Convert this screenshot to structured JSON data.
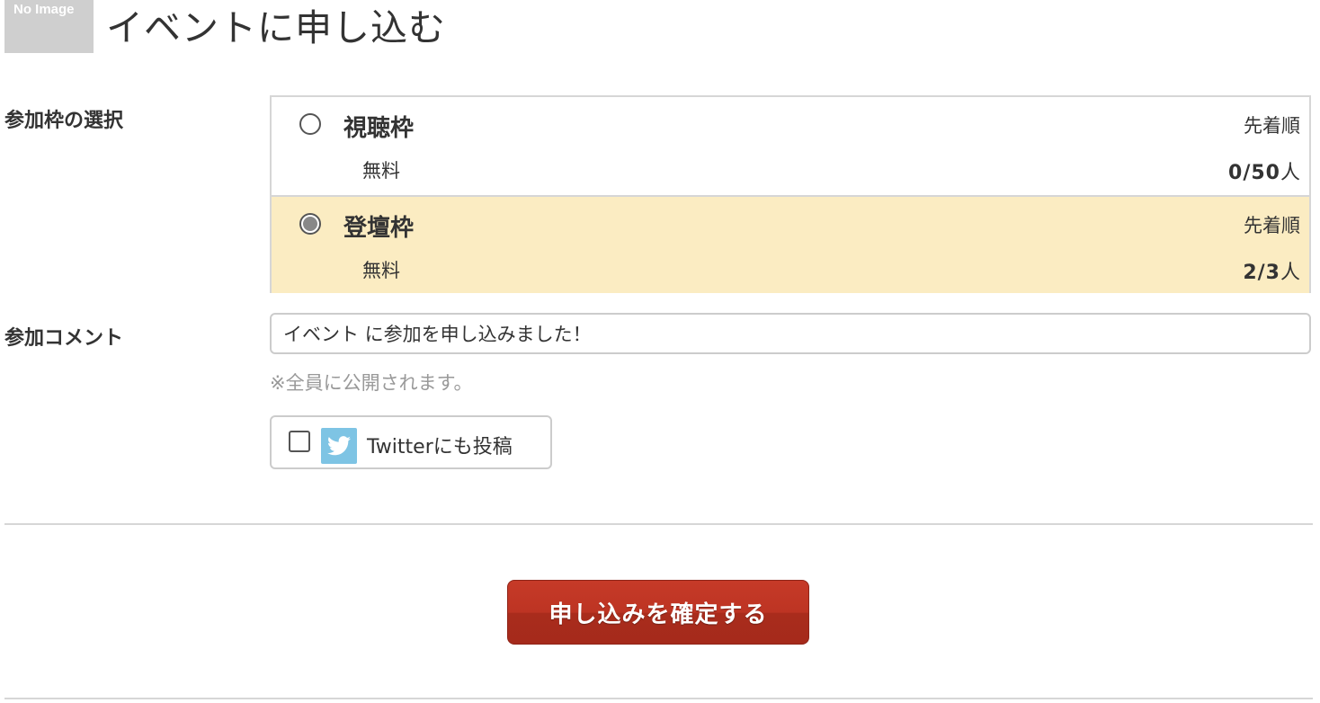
{
  "header": {
    "thumbnail_text": "No Image",
    "title": "イベントに申し込む"
  },
  "slot_selection": {
    "label": "参加枠の選択",
    "options": [
      {
        "name": "視聴枠",
        "order": "先着順",
        "price": "無料",
        "capacity_count": "0/50",
        "capacity_unit": "人",
        "selected": false
      },
      {
        "name": "登壇枠",
        "order": "先着順",
        "price": "無料",
        "capacity_count": "2/3",
        "capacity_unit": "人",
        "selected": true
      }
    ]
  },
  "comment": {
    "label": "参加コメント",
    "value": "イベント に参加を申し込みました！",
    "note": "※全員に公開されます。"
  },
  "twitter": {
    "label": "Twitterにも投稿",
    "checked": false
  },
  "submit": {
    "label": "申し込みを確定する"
  },
  "colors": {
    "selected_row_bg": "#fbecc2",
    "submit_bg": "#bd3423",
    "twitter_icon_bg": "#7ec4e4"
  }
}
